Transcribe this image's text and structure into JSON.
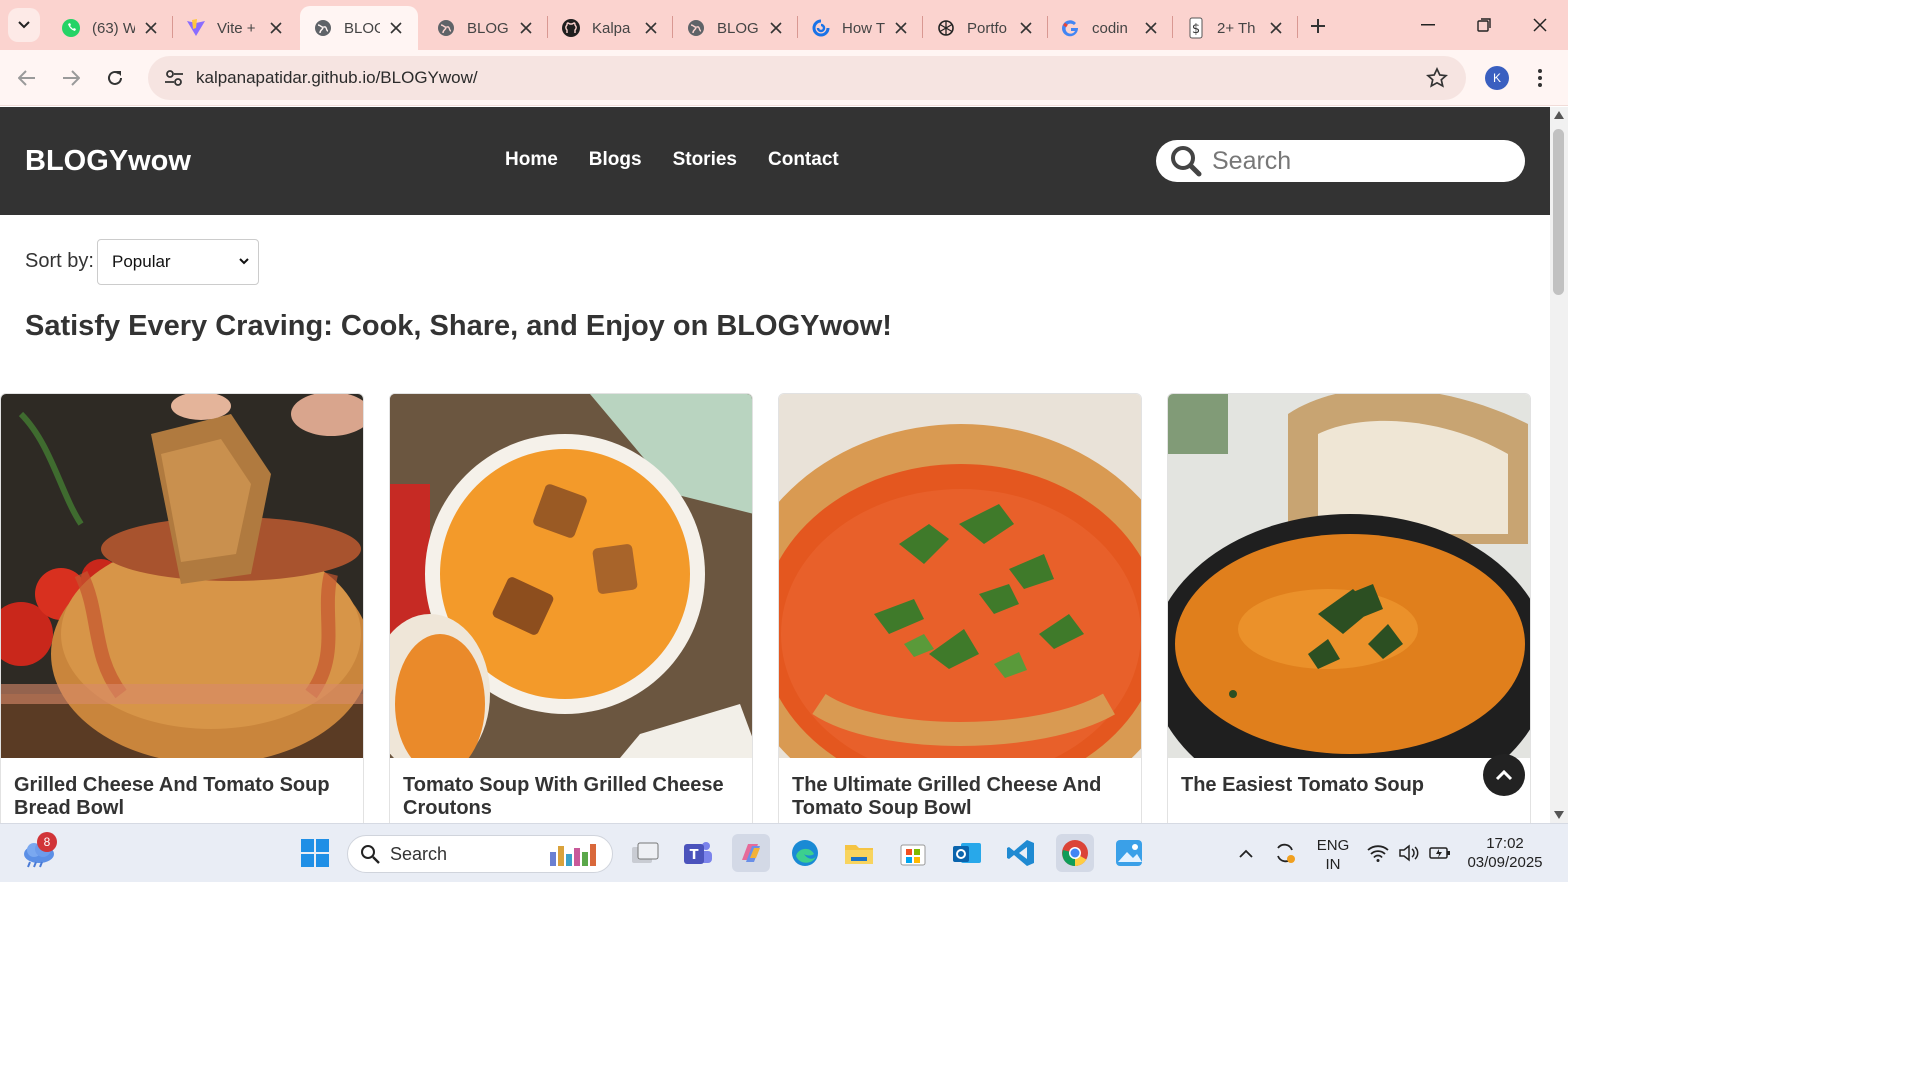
{
  "browser": {
    "tabs": [
      {
        "title": "(63) W",
        "icon": "whatsapp-icon",
        "active": false
      },
      {
        "title": "Vite +",
        "icon": "vite-icon",
        "active": false
      },
      {
        "title": "BLOG",
        "icon": "globe-icon",
        "active": true
      },
      {
        "title": "BLOG",
        "icon": "globe-icon",
        "active": false
      },
      {
        "title": "Kalpa",
        "icon": "github-icon",
        "active": false
      },
      {
        "title": "BLOG",
        "icon": "globe-icon",
        "active": false
      },
      {
        "title": "How T",
        "icon": "loop-icon",
        "active": false
      },
      {
        "title": "Portfo",
        "icon": "openai-icon",
        "active": false
      },
      {
        "title": "codin",
        "icon": "google-icon",
        "active": false
      },
      {
        "title": "2+ Th",
        "icon": "dollar-icon",
        "active": false
      }
    ],
    "url": "kalpanapatidar.github.io/BLOGYwow/",
    "profile_initial": "K"
  },
  "site": {
    "logo": "BLOGYwow",
    "nav": [
      "Home",
      "Blogs",
      "Stories",
      "Contact"
    ],
    "search_placeholder": "Search",
    "sort_label": "Sort by:",
    "sort_value": "Popular",
    "headline": "Satisfy Every Craving: Cook, Share, and Enjoy on BLOGYwow!",
    "cards": [
      {
        "title": "Grilled Cheese And Tomato Soup Bread Bowl"
      },
      {
        "title": "Tomato Soup With Grilled Cheese Croutons"
      },
      {
        "title": "The Ultimate Grilled Cheese And Tomato Soup Bowl"
      },
      {
        "title": "The Easiest Tomato Soup"
      }
    ]
  },
  "taskbar": {
    "weather_badge": "8",
    "search_label": "Search",
    "lang_line1": "ENG",
    "lang_line2": "IN",
    "time": "17:02",
    "date": "03/09/2025"
  },
  "colors": {
    "tabstrip": "#fbd3cf",
    "site_header": "#333333",
    "accent": "#3a5fc0"
  }
}
